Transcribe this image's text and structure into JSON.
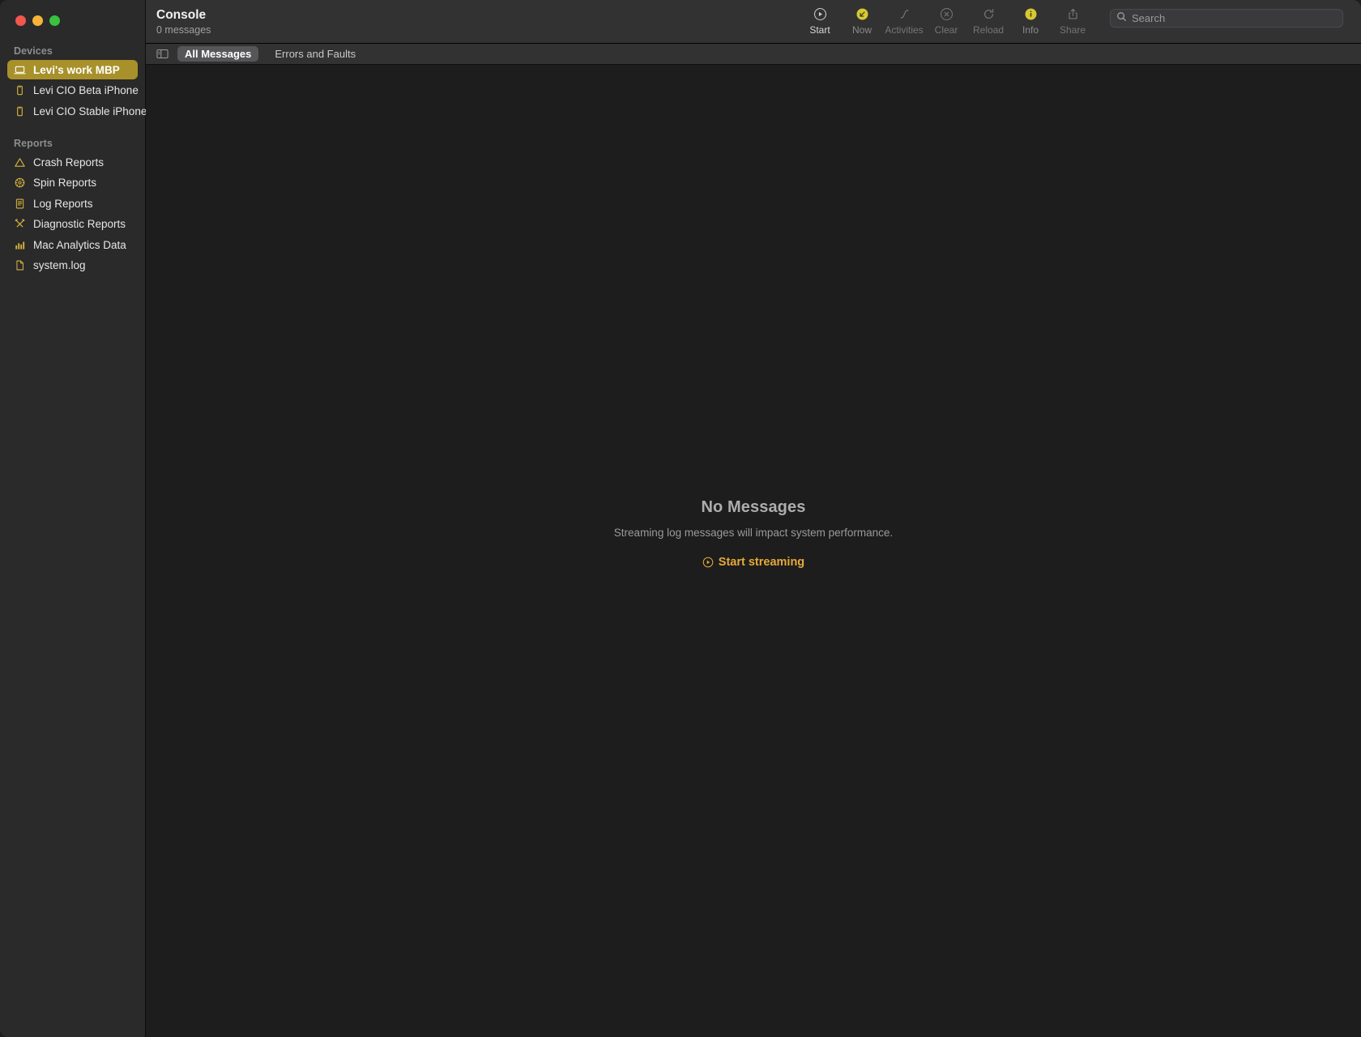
{
  "window": {
    "traffic_lights": [
      {
        "name": "close-button",
        "color": "#f2574d"
      },
      {
        "name": "minimize-button",
        "color": "#f5b53a"
      },
      {
        "name": "maximize-button",
        "color": "#39c23f"
      }
    ]
  },
  "sidebar": {
    "devices_header": "Devices",
    "devices": [
      {
        "label": "Levi's work MBP",
        "icon": "laptop-icon",
        "selected": true
      },
      {
        "label": "Levi CIO Beta iPhone",
        "icon": "iphone-icon",
        "selected": false
      },
      {
        "label": "Levi CIO Stable iPhone",
        "icon": "iphone-icon",
        "selected": false
      }
    ],
    "reports_header": "Reports",
    "reports": [
      {
        "label": "Crash Reports",
        "icon": "warning-triangle-icon"
      },
      {
        "label": "Spin Reports",
        "icon": "spinner-wheel-icon"
      },
      {
        "label": "Log Reports",
        "icon": "document-lines-icon"
      },
      {
        "label": "Diagnostic Reports",
        "icon": "tools-icon"
      },
      {
        "label": "Mac Analytics Data",
        "icon": "bar-chart-icon"
      },
      {
        "label": "system.log",
        "icon": "file-icon"
      }
    ],
    "selected_color": "#a8912a"
  },
  "header": {
    "title": "Console",
    "message_count": "0 messages"
  },
  "toolbar": {
    "buttons": [
      {
        "label": "Start",
        "icon": "play-circle-icon",
        "state": "active"
      },
      {
        "label": "Now",
        "icon": "now-arrow-icon",
        "state": "highlighted"
      },
      {
        "label": "Activities",
        "icon": "activities-icon",
        "state": "dim"
      },
      {
        "label": "Clear",
        "icon": "clear-circle-icon",
        "state": "dim"
      },
      {
        "label": "Reload",
        "icon": "reload-icon",
        "state": "dim"
      },
      {
        "label": "Info",
        "icon": "info-circle-icon",
        "state": "highlighted"
      },
      {
        "label": "Share",
        "icon": "share-icon",
        "state": "dim"
      }
    ],
    "accent_color": "#d8c832"
  },
  "search": {
    "placeholder": "Search",
    "value": "",
    "icon": "search-icon"
  },
  "filter_bar": {
    "sidebar_toggle_icon": "sidebar-toggle-icon",
    "tabs": [
      {
        "label": "All Messages",
        "selected": true
      },
      {
        "label": "Errors and Faults",
        "selected": false
      }
    ]
  },
  "main": {
    "empty_title": "No Messages",
    "empty_subtitle": "Streaming log messages will impact system performance.",
    "start_streaming_label": "Start streaming",
    "start_streaming_icon": "play-circle-icon",
    "link_color": "#e5a93a"
  }
}
